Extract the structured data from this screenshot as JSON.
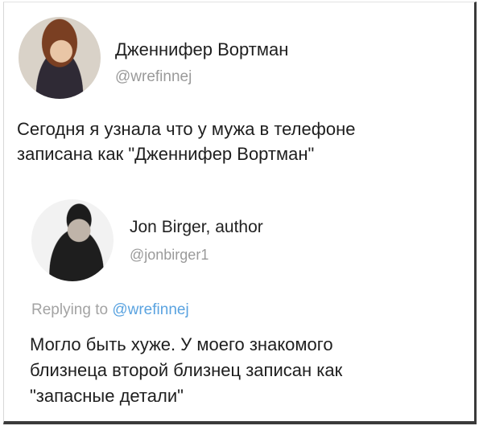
{
  "main_tweet": {
    "display_name": "Дженнифер Вортман",
    "handle": "@wrefinnej",
    "text": "Сегодня я узнала что у мужа в телефоне\nзаписана как \"Дженнифер Вортман\""
  },
  "reply_tweet": {
    "display_name": "Jon Birger, author",
    "handle": "@jonbirger1",
    "replying_prefix": "Replying to ",
    "replying_mention": "@wrefinnej",
    "text": "Могло быть хуже. У моего знакомого\nблизнеца второй близнец записан как\n\"запасные детали\""
  },
  "colors": {
    "mention": "#5aa3e0",
    "muted": "#9a9a9a"
  }
}
